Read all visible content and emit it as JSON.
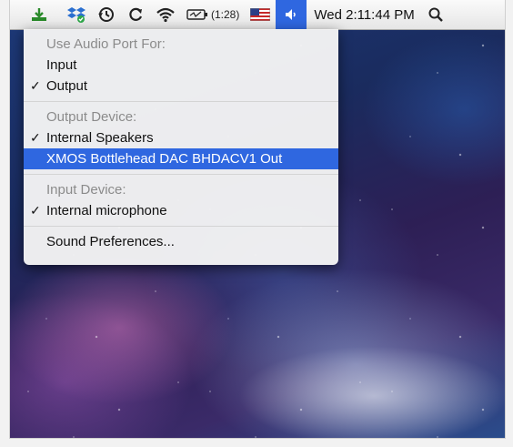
{
  "menubar": {
    "icons": [
      "download-icon",
      "dropbox-sync-icon",
      "time-machine-icon",
      "sync-icon",
      "wifi-icon",
      "battery-icon",
      "us-flag-icon",
      "speaker-icon",
      "spotlight-icon"
    ],
    "battery_time": "(1:28)",
    "clock": "Wed 2:11:44 PM",
    "accent_color": "#2f67e0"
  },
  "audio_menu": {
    "port_header": "Use Audio Port For:",
    "port_items": [
      {
        "label": "Input",
        "checked": false
      },
      {
        "label": "Output",
        "checked": true
      }
    ],
    "output_header": "Output Device:",
    "output_items": [
      {
        "label": "Internal Speakers",
        "checked": true
      },
      {
        "label": "XMOS Bottlehead DAC BHDACV1 Out",
        "checked": false,
        "highlighted": true
      }
    ],
    "input_header": "Input Device:",
    "input_items": [
      {
        "label": "Internal microphone",
        "checked": true
      }
    ],
    "prefs_label": "Sound Preferences...",
    "check_glyph": "✓"
  }
}
